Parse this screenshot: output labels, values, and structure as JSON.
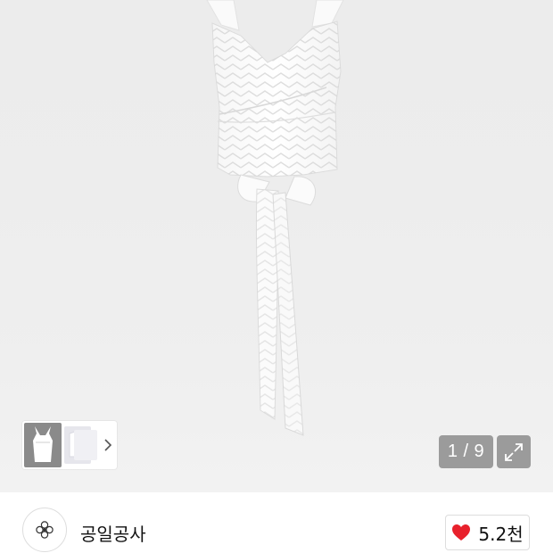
{
  "gallery": {
    "current_page": "1",
    "separator": "/",
    "total_pages": "9"
  },
  "seller": {
    "name": "공일공사"
  },
  "like": {
    "count": "5.2천"
  },
  "icons": {
    "thumbnail_arrow": "chevron-right-icon",
    "expand": "expand-icon",
    "like": "heart-icon",
    "avatar": "flower-logo-icon"
  },
  "colors": {
    "heart": "#e8212c",
    "counter_bg": "#8c8c8c"
  }
}
